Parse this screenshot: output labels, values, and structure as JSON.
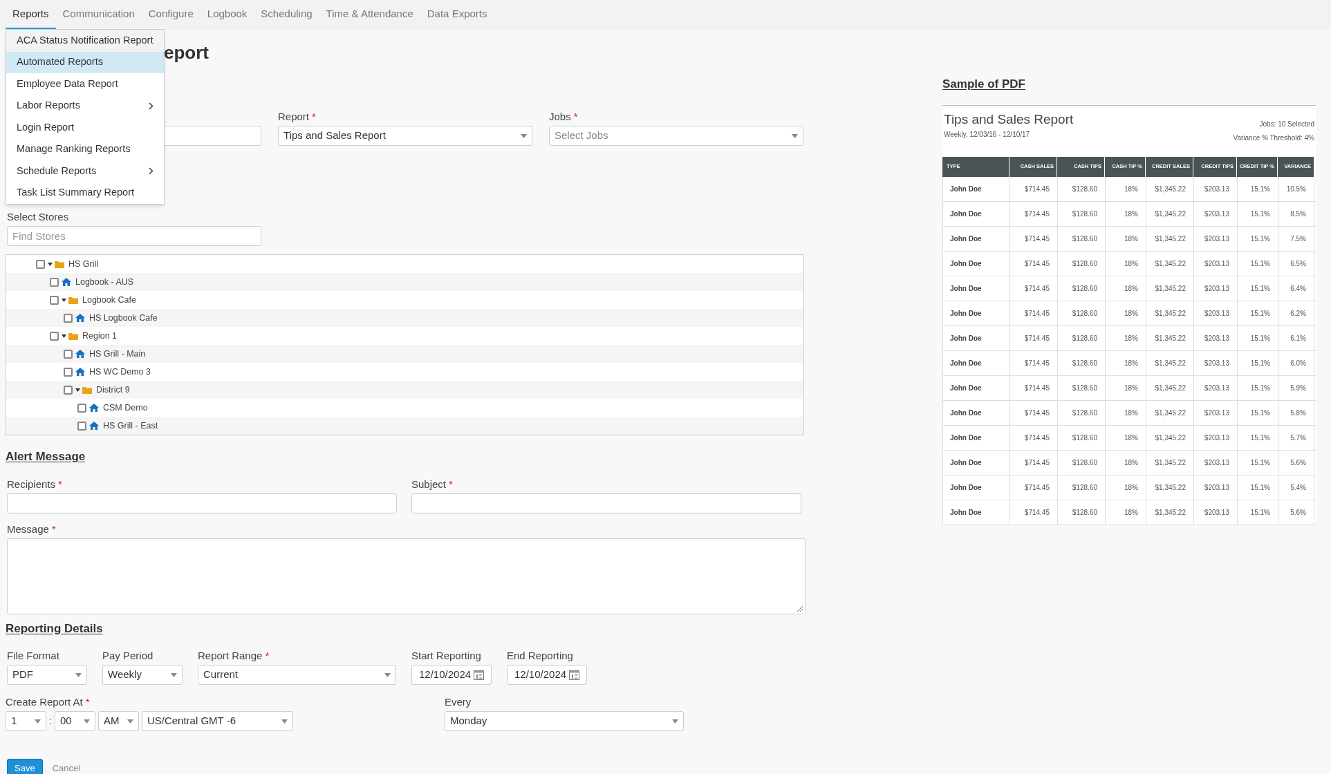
{
  "nav": {
    "tabs": [
      {
        "label": "Reports",
        "selected": true
      },
      {
        "label": "Communication",
        "selected": false
      },
      {
        "label": "Configure",
        "selected": false
      },
      {
        "label": "Logbook",
        "selected": false
      },
      {
        "label": "Scheduling",
        "selected": false
      },
      {
        "label": "Time & Attendance",
        "selected": false
      },
      {
        "label": "Data Exports",
        "selected": false
      }
    ]
  },
  "menu": {
    "items": [
      {
        "label": "ACA Status Notification Report",
        "selected": false,
        "submenu": false
      },
      {
        "label": "Automated Reports",
        "selected": true,
        "submenu": false
      },
      {
        "label": "Employee Data Report",
        "selected": false,
        "submenu": false
      },
      {
        "label": "Labor Reports",
        "selected": false,
        "submenu": true
      },
      {
        "label": "Login Report",
        "selected": false,
        "submenu": false
      },
      {
        "label": "Manage Ranking Reports",
        "selected": false,
        "submenu": false
      },
      {
        "label": "Schedule Reports",
        "selected": false,
        "submenu": true
      },
      {
        "label": "Task List Summary Report",
        "selected": false,
        "submenu": false
      }
    ]
  },
  "page_title": "eport",
  "top_fields": [
    {
      "kind": "text"
    },
    {
      "kind": "select",
      "label": "Report",
      "required_mark": "*",
      "value": "Tips and Sales Report"
    },
    {
      "kind": "select",
      "label": "Jobs",
      "required_mark": "*",
      "placeholder": "Select Jobs"
    }
  ],
  "stores": {
    "label": "Select Stores",
    "placeholder": "Find Stores",
    "tree": [
      {
        "label": "HS Grill",
        "kind": "folder",
        "checked": false,
        "expanded": true,
        "children": [
          {
            "label": "Logbook - AUS",
            "kind": "store",
            "checked": false
          },
          {
            "label": "Logbook Cafe",
            "kind": "folder",
            "checked": false,
            "expanded": true,
            "children": [
              {
                "label": "HS Logbook Cafe",
                "kind": "store",
                "checked": false
              }
            ]
          },
          {
            "label": "Region 1",
            "kind": "folder",
            "checked": false,
            "expanded": true,
            "children": [
              {
                "label": "HS Grill - Main",
                "kind": "store",
                "checked": false
              },
              {
                "label": "HS WC Demo 3",
                "kind": "store",
                "checked": false
              },
              {
                "label": "District 9",
                "kind": "folder",
                "checked": false,
                "expanded": true,
                "children": [
                  {
                    "label": "CSM Demo",
                    "kind": "store",
                    "checked": false
                  },
                  {
                    "label": "HS Grill - East",
                    "kind": "store",
                    "checked": false
                  }
                ]
              }
            ]
          }
        ]
      }
    ]
  },
  "alert": {
    "heading": "Alert Message",
    "recipients": {
      "label": "Recipients",
      "required_mark": "*"
    },
    "subject": {
      "label": "Subject",
      "required_mark": "*"
    },
    "message": {
      "label": "Message",
      "required_mark": "*"
    }
  },
  "reporting": {
    "heading": "Reporting Details",
    "fields": [
      {
        "kind": "select",
        "label": "File Format",
        "value": "PDF"
      },
      {
        "kind": "select",
        "label": "Pay Period",
        "value": "Weekly"
      },
      {
        "kind": "select",
        "label": "Report Range",
        "required_mark": "*",
        "value": "Current"
      },
      {
        "kind": "date",
        "label": "Start Reporting",
        "value": "12/10/2024"
      },
      {
        "kind": "date",
        "label": "End Reporting",
        "value": "12/10/2024"
      }
    ],
    "create_at": {
      "label": "Create Report At",
      "required_mark": "*",
      "hour": "1",
      "separator": ":",
      "minute": "00",
      "ampm": "AM",
      "timezone": "US/Central GMT -6"
    },
    "every": {
      "label": "Every",
      "value": "Monday"
    }
  },
  "buttons": {
    "save": "Save",
    "cancel": "Cancel"
  },
  "sample": {
    "heading": "Sample of PDF",
    "title": "Tips and Sales Report",
    "subtitle": "Weekly, 12/03/16 - 12/10/17",
    "jobs": "Jobs: 10 Selected",
    "threshold": "Variance % Threshold: 4%",
    "columns": [
      "TYPE",
      "CASH SALES",
      "CASH TIPS",
      "CASH TIP %",
      "CREDIT SALES",
      "CREDIT TIPS",
      "CREDIT TIP %",
      "VARIANCE"
    ],
    "rows": [
      [
        "John Doe",
        "$714.45",
        "$128.60",
        "18%",
        "$1,345.22",
        "$203.13",
        "15.1%",
        "10.5%"
      ],
      [
        "John Doe",
        "$714.45",
        "$128.60",
        "18%",
        "$1,345.22",
        "$203.13",
        "15.1%",
        "8.5%"
      ],
      [
        "John Doe",
        "$714.45",
        "$128.60",
        "18%",
        "$1,345.22",
        "$203.13",
        "15.1%",
        "7.5%"
      ],
      [
        "John Doe",
        "$714.45",
        "$128.60",
        "18%",
        "$1,345.22",
        "$203.13",
        "15.1%",
        "6.5%"
      ],
      [
        "John Doe",
        "$714.45",
        "$128.60",
        "18%",
        "$1,345.22",
        "$203.13",
        "15.1%",
        "6.4%"
      ],
      [
        "John Doe",
        "$714.45",
        "$128.60",
        "18%",
        "$1,345.22",
        "$203.13",
        "15.1%",
        "6.2%"
      ],
      [
        "John Doe",
        "$714.45",
        "$128.60",
        "18%",
        "$1,345.22",
        "$203.13",
        "15.1%",
        "6.1%"
      ],
      [
        "John Doe",
        "$714.45",
        "$128.60",
        "18%",
        "$1,345.22",
        "$203.13",
        "15.1%",
        "6.0%"
      ],
      [
        "John Doe",
        "$714.45",
        "$128.60",
        "18%",
        "$1,345.22",
        "$203.13",
        "15.1%",
        "5.9%"
      ],
      [
        "John Doe",
        "$714.45",
        "$128.60",
        "18%",
        "$1,345.22",
        "$203.13",
        "15.1%",
        "5.8%"
      ],
      [
        "John Doe",
        "$714.45",
        "$128.60",
        "18%",
        "$1,345.22",
        "$203.13",
        "15.1%",
        "5.7%"
      ],
      [
        "John Doe",
        "$714.45",
        "$128.60",
        "18%",
        "$1,345.22",
        "$203.13",
        "15.1%",
        "5.6%"
      ],
      [
        "John Doe",
        "$714.45",
        "$128.60",
        "18%",
        "$1,345.22",
        "$203.13",
        "15.1%",
        "5.4%"
      ],
      [
        "John Doe",
        "$714.45",
        "$128.60",
        "18%",
        "$1,345.22",
        "$203.13",
        "15.1%",
        "5.6%"
      ]
    ]
  }
}
